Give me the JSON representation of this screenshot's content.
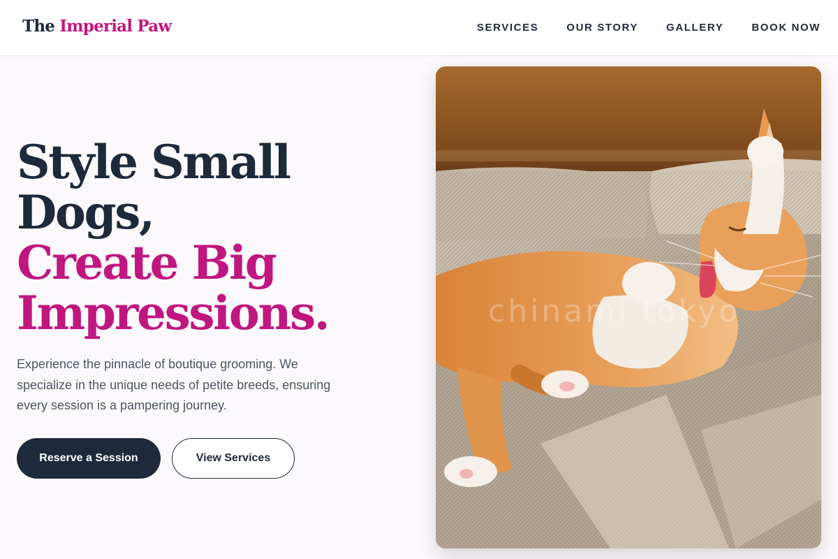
{
  "header": {
    "logo_part1": "The",
    "logo_part2": "Imperial Paw",
    "nav": [
      "SERVICES",
      "OUR STORY",
      "GALLERY",
      "BOOK NOW"
    ]
  },
  "hero": {
    "headline_line1": "Style Small",
    "headline_line2": "Dogs,",
    "headline_line3": "Create Big",
    "headline_line4": "Impressions.",
    "description": "Experience the pinnacle of boutique grooming. We specialize in the unique needs of petite breeds, ensuring every session is a pampering journey.",
    "primary_button": "Reserve a Session",
    "secondary_button": "View Services",
    "image_alt": "Orange and white cat stretching on a sunlit couch",
    "image_watermark": "chinami tokyo"
  },
  "colors": {
    "navy": "#1e293b",
    "accent_pink": "#c0177f",
    "page_bg": "#fcf9fc"
  }
}
